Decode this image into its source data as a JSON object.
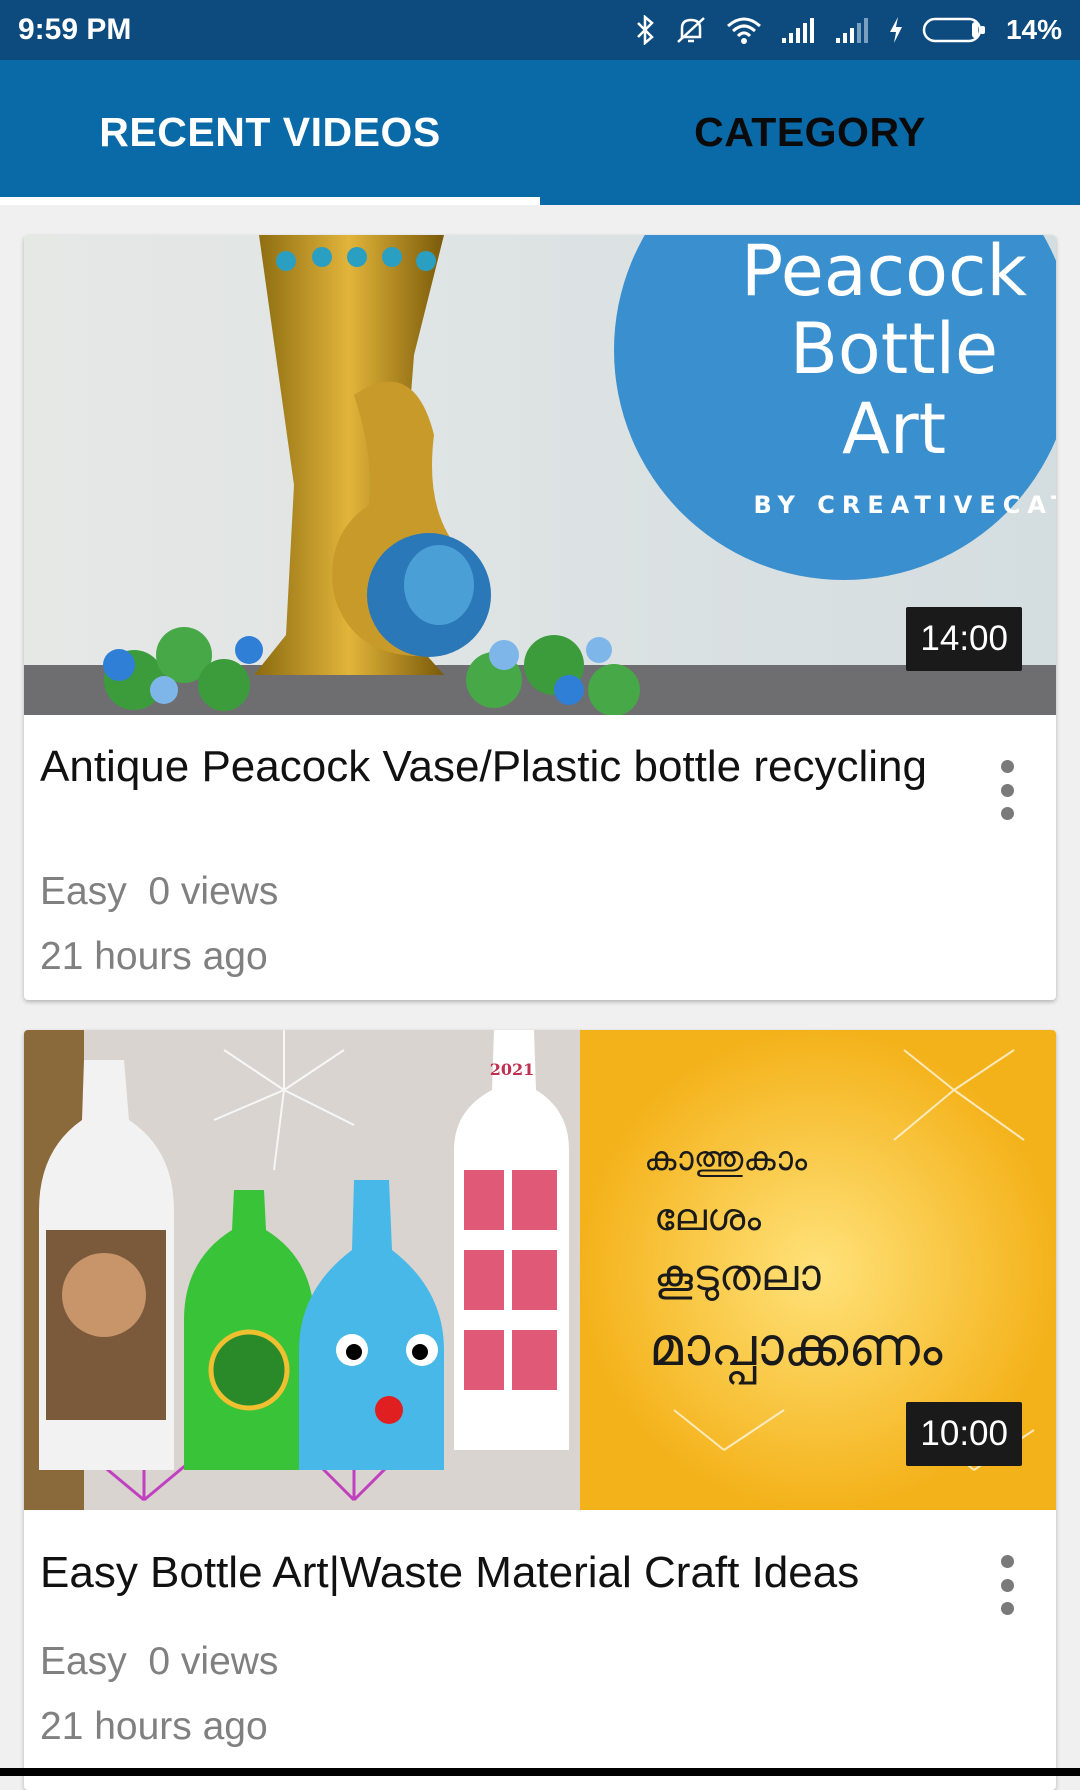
{
  "status_bar": {
    "time": "9:59 PM",
    "battery": "14%",
    "icons": [
      "bluetooth-icon",
      "mute-icon",
      "wifi-icon",
      "signal-icon",
      "signal-icon",
      "charging-icon",
      "battery-icon"
    ]
  },
  "tabs": [
    {
      "label": "RECENT VIDEOS",
      "active": true
    },
    {
      "label": "CATEGORY",
      "active": false
    }
  ],
  "colors": {
    "status_bar": "#0d4a7d",
    "tab_bar": "#0a6aa8",
    "active_tab_text": "#ffffff",
    "inactive_tab_text": "#0a0a0a"
  },
  "videos": [
    {
      "title": "Antique Peacock Vase/Plastic bottle recycling",
      "difficulty": "Easy",
      "views": "0 views",
      "time_ago": "21 hours ago",
      "duration": "14:00",
      "thumbnail": {
        "line1": "Peacock",
        "line2": "Bottle",
        "line3": "Art",
        "byline": "BY CREATIVECAT"
      }
    },
    {
      "title": "Easy Bottle Art|Waste Material Craft Ideas",
      "difficulty": "Easy",
      "views": "0 views",
      "time_ago": "21 hours ago",
      "duration": "10:00",
      "thumbnail": {
        "label_2021": "2021",
        "malayalam_line1": "കാത്തുകാം",
        "malayalam_line2": "ലേശം",
        "malayalam_line3": "കൂടുതലാ",
        "malayalam_line4": "മാപ്പാക്കണം"
      }
    }
  ]
}
